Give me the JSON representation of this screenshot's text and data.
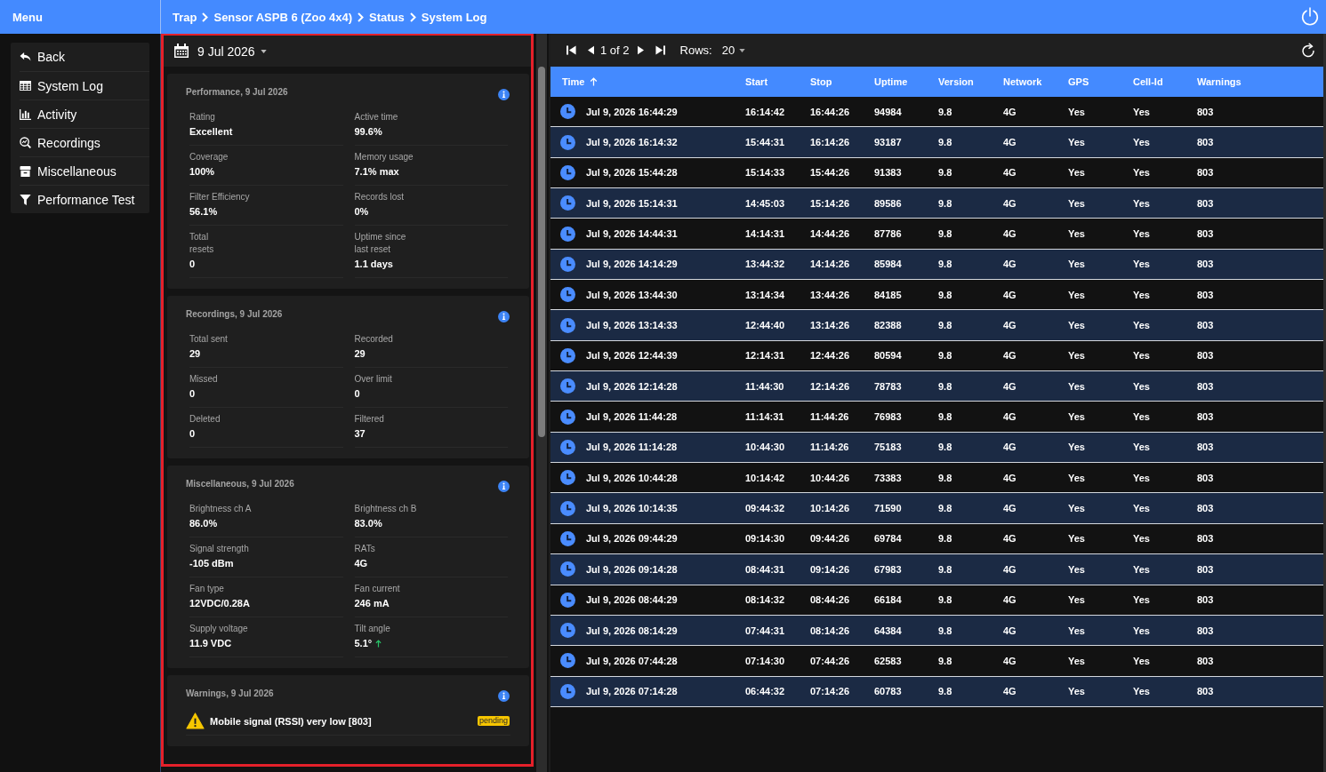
{
  "menu_header": {
    "title": "Menu"
  },
  "breadcrumb": [
    "Trap",
    "Sensor ASPB 6 (Zoo 4x4)",
    "Status",
    "System Log"
  ],
  "sidebar": {
    "items": [
      {
        "label": "Back"
      },
      {
        "label": "System Log"
      },
      {
        "label": "Activity"
      },
      {
        "label": "Recordings"
      },
      {
        "label": "Miscellaneous"
      },
      {
        "label": "Performance Test"
      }
    ]
  },
  "date_picker": {
    "value": "9 Jul 2026"
  },
  "cards": [
    {
      "kind": "stats",
      "title": "Performance, 9 Jul 2026",
      "fields": [
        {
          "label": "Rating",
          "value": "Excellent",
          "rising": false
        },
        {
          "label": "Active time",
          "value": "99.6%",
          "rising": false
        },
        {
          "label": "Coverage",
          "value": "100%",
          "rising": false
        },
        {
          "label": "Memory usage",
          "value": "7.1% max",
          "rising": false
        },
        {
          "label": "Filter Efficiency",
          "value": "56.1%",
          "rising": false
        },
        {
          "label": "Records lost",
          "value": "0%",
          "rising": false
        },
        {
          "label": "Total\nresets",
          "value": "0",
          "rising": false
        },
        {
          "label": "Uptime since\nlast reset",
          "value": "1.1 days",
          "rising": false
        }
      ]
    },
    {
      "kind": "stats",
      "title": "Recordings, 9 Jul 2026",
      "fields": [
        {
          "label": "Total sent",
          "value": "29",
          "rising": false
        },
        {
          "label": "Recorded",
          "value": "29",
          "rising": false
        },
        {
          "label": "Missed",
          "value": "0",
          "rising": false
        },
        {
          "label": "Over limit",
          "value": "0",
          "rising": false
        },
        {
          "label": "Deleted",
          "value": "0",
          "rising": false
        },
        {
          "label": "Filtered",
          "value": "37",
          "rising": false
        }
      ]
    },
    {
      "kind": "stats",
      "title": "Miscellaneous, 9 Jul 2026",
      "fields": [
        {
          "label": "Brightness ch A",
          "value": "86.0%",
          "rising": false
        },
        {
          "label": "Brightness ch B",
          "value": "83.0%",
          "rising": false
        },
        {
          "label": "Signal strength",
          "value": "-105 dBm",
          "rising": false
        },
        {
          "label": "RATs",
          "value": "4G",
          "rising": false
        },
        {
          "label": "Fan type",
          "value": "12VDC/0.28A",
          "rising": false
        },
        {
          "label": "Fan current",
          "value": "246 mA",
          "rising": false
        },
        {
          "label": "Supply voltage",
          "value": "11.9 VDC",
          "rising": false
        },
        {
          "label": "Tilt angle",
          "value": "5.1°",
          "rising": true
        }
      ]
    },
    {
      "kind": "warnings",
      "title": "Warnings, 9 Jul 2026",
      "warnings": [
        {
          "kind": "warning",
          "text": "Mobile signal (RSSI) very low [803]",
          "status": "pending"
        }
      ]
    }
  ],
  "pager": {
    "page_info": "1 of 2",
    "rows_label": "Rows:",
    "rows_per_page": "20"
  },
  "table": {
    "columns": [
      {
        "label": "Time",
        "sorted": true
      },
      {
        "label": "Start",
        "sorted": false
      },
      {
        "label": "Stop",
        "sorted": false
      },
      {
        "label": "Uptime",
        "sorted": false
      },
      {
        "label": "Version",
        "sorted": false
      },
      {
        "label": "Network",
        "sorted": false
      },
      {
        "label": "GPS",
        "sorted": false
      },
      {
        "label": "Cell-Id",
        "sorted": false
      },
      {
        "label": "Warnings",
        "sorted": false
      }
    ],
    "rows": [
      {
        "cells": [
          "Jul 9, 2026 16:44:29",
          "16:14:42",
          "16:44:26",
          "94984",
          "9.8",
          "4G",
          "Yes",
          "Yes",
          "803"
        ]
      },
      {
        "cells": [
          "Jul 9, 2026 16:14:32",
          "15:44:31",
          "16:14:26",
          "93187",
          "9.8",
          "4G",
          "Yes",
          "Yes",
          "803"
        ]
      },
      {
        "cells": [
          "Jul 9, 2026 15:44:28",
          "15:14:33",
          "15:44:26",
          "91383",
          "9.8",
          "4G",
          "Yes",
          "Yes",
          "803"
        ]
      },
      {
        "cells": [
          "Jul 9, 2026 15:14:31",
          "14:45:03",
          "15:14:26",
          "89586",
          "9.8",
          "4G",
          "Yes",
          "Yes",
          "803"
        ]
      },
      {
        "cells": [
          "Jul 9, 2026 14:44:31",
          "14:14:31",
          "14:44:26",
          "87786",
          "9.8",
          "4G",
          "Yes",
          "Yes",
          "803"
        ]
      },
      {
        "cells": [
          "Jul 9, 2026 14:14:29",
          "13:44:32",
          "14:14:26",
          "85984",
          "9.8",
          "4G",
          "Yes",
          "Yes",
          "803"
        ]
      },
      {
        "cells": [
          "Jul 9, 2026 13:44:30",
          "13:14:34",
          "13:44:26",
          "84185",
          "9.8",
          "4G",
          "Yes",
          "Yes",
          "803"
        ]
      },
      {
        "cells": [
          "Jul 9, 2026 13:14:33",
          "12:44:40",
          "13:14:26",
          "82388",
          "9.8",
          "4G",
          "Yes",
          "Yes",
          "803"
        ]
      },
      {
        "cells": [
          "Jul 9, 2026 12:44:39",
          "12:14:31",
          "12:44:26",
          "80594",
          "9.8",
          "4G",
          "Yes",
          "Yes",
          "803"
        ]
      },
      {
        "cells": [
          "Jul 9, 2026 12:14:28",
          "11:44:30",
          "12:14:26",
          "78783",
          "9.8",
          "4G",
          "Yes",
          "Yes",
          "803"
        ]
      },
      {
        "cells": [
          "Jul 9, 2026 11:44:28",
          "11:14:31",
          "11:44:26",
          "76983",
          "9.8",
          "4G",
          "Yes",
          "Yes",
          "803"
        ]
      },
      {
        "cells": [
          "Jul 9, 2026 11:14:28",
          "10:44:30",
          "11:14:26",
          "75183",
          "9.8",
          "4G",
          "Yes",
          "Yes",
          "803"
        ]
      },
      {
        "cells": [
          "Jul 9, 2026 10:44:28",
          "10:14:42",
          "10:44:26",
          "73383",
          "9.8",
          "4G",
          "Yes",
          "Yes",
          "803"
        ]
      },
      {
        "cells": [
          "Jul 9, 2026 10:14:35",
          "09:44:32",
          "10:14:26",
          "71590",
          "9.8",
          "4G",
          "Yes",
          "Yes",
          "803"
        ]
      },
      {
        "cells": [
          "Jul 9, 2026 09:44:29",
          "09:14:30",
          "09:44:26",
          "69784",
          "9.8",
          "4G",
          "Yes",
          "Yes",
          "803"
        ]
      },
      {
        "cells": [
          "Jul 9, 2026 09:14:28",
          "08:44:31",
          "09:14:26",
          "67983",
          "9.8",
          "4G",
          "Yes",
          "Yes",
          "803"
        ]
      },
      {
        "cells": [
          "Jul 9, 2026 08:44:29",
          "08:14:32",
          "08:44:26",
          "66184",
          "9.8",
          "4G",
          "Yes",
          "Yes",
          "803"
        ]
      },
      {
        "cells": [
          "Jul 9, 2026 08:14:29",
          "07:44:31",
          "08:14:26",
          "64384",
          "9.8",
          "4G",
          "Yes",
          "Yes",
          "803"
        ]
      },
      {
        "cells": [
          "Jul 9, 2026 07:44:28",
          "07:14:30",
          "07:44:26",
          "62583",
          "9.8",
          "4G",
          "Yes",
          "Yes",
          "803"
        ]
      },
      {
        "cells": [
          "Jul 9, 2026 07:14:28",
          "06:44:32",
          "07:14:26",
          "60783",
          "9.8",
          "4G",
          "Yes",
          "Yes",
          "803"
        ]
      }
    ]
  }
}
